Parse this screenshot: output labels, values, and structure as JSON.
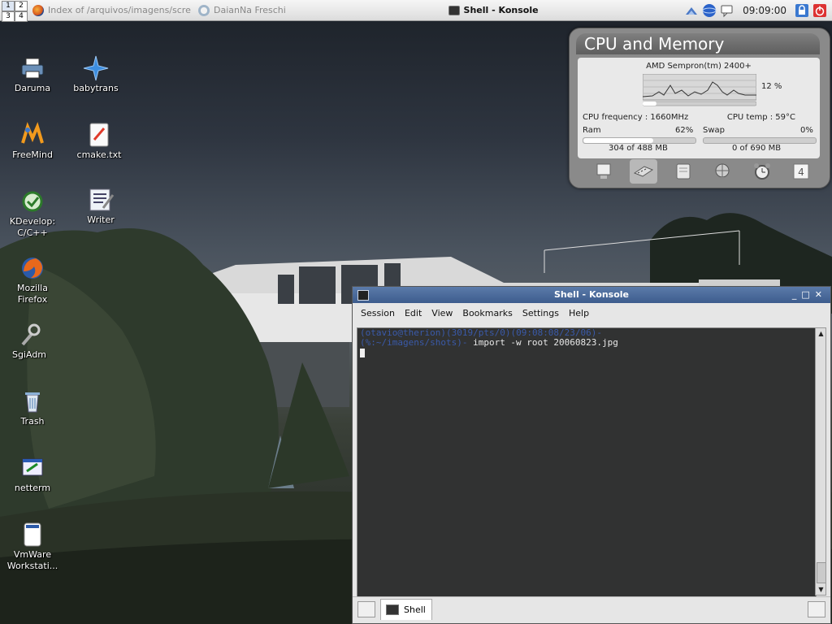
{
  "panel": {
    "pager": [
      "1",
      "2",
      "3",
      "4"
    ],
    "tasks": [
      {
        "label": "Index of /arquivos/imagens/scre",
        "icon": "firefox-icon"
      },
      {
        "label": "DaianNa Freschi",
        "icon": "chat-icon"
      },
      {
        "label": "Shell - Konsole",
        "icon": "terminal-icon"
      }
    ],
    "clock": "09:09:00"
  },
  "desktop": {
    "icons": [
      {
        "label": "Daruma",
        "icon": "printer-icon"
      },
      {
        "label": "babytrans",
        "icon": "star-icon"
      },
      {
        "label": "FreeMind",
        "icon": "freemind-icon"
      },
      {
        "label": "cmake.txt",
        "icon": "text-file-icon"
      },
      {
        "label": "KDevelop: C/C++",
        "icon": "kdevelop-icon"
      },
      {
        "label": "Writer",
        "icon": "writer-icon"
      },
      {
        "label": "Mozilla Firefox",
        "icon": "firefox-icon"
      },
      {
        "label": "SgiAdm",
        "icon": "wrench-icon"
      },
      {
        "label": "Trash",
        "icon": "trash-icon"
      },
      {
        "label": "netterm",
        "icon": "terminal-window-icon"
      },
      {
        "label": "VmWare Workstati...",
        "icon": "vmware-icon"
      }
    ]
  },
  "cpu_widget": {
    "title": "CPU and Memory",
    "processor": "AMD Sempron(tm) 2400+",
    "usage": "12 %",
    "usage_fraction": 0.12,
    "frequency": "CPU frequency : 1660MHz",
    "temp": "CPU temp : 59°C",
    "ram_label": "Ram",
    "ram_percent": "62%",
    "ram_fraction": 0.62,
    "ram_detail": "304 of 488 MB",
    "swap_label": "Swap",
    "swap_percent": "0%",
    "swap_fraction": 0.0,
    "swap_detail": "0 of 690 MB",
    "tabs": [
      "monitor-icon",
      "memory-icon",
      "disk-icon",
      "network-icon",
      "alarm-clock-icon",
      "calendar-icon"
    ],
    "calendar_day": "4"
  },
  "konsole": {
    "title": "Shell - Konsole",
    "menu": [
      "Session",
      "Edit",
      "View",
      "Bookmarks",
      "Settings",
      "Help"
    ],
    "line1_user": "(otavio@therion)",
    "line1_tty": "(3019/pts/0)",
    "line1_time": "(09:08:08/23/06)",
    "line1_tail": "-",
    "line2_path": "(%:~/imagens/shots)-",
    "line2_cmd": " import -w root 20060823.jpg",
    "tab_label": "Shell"
  }
}
